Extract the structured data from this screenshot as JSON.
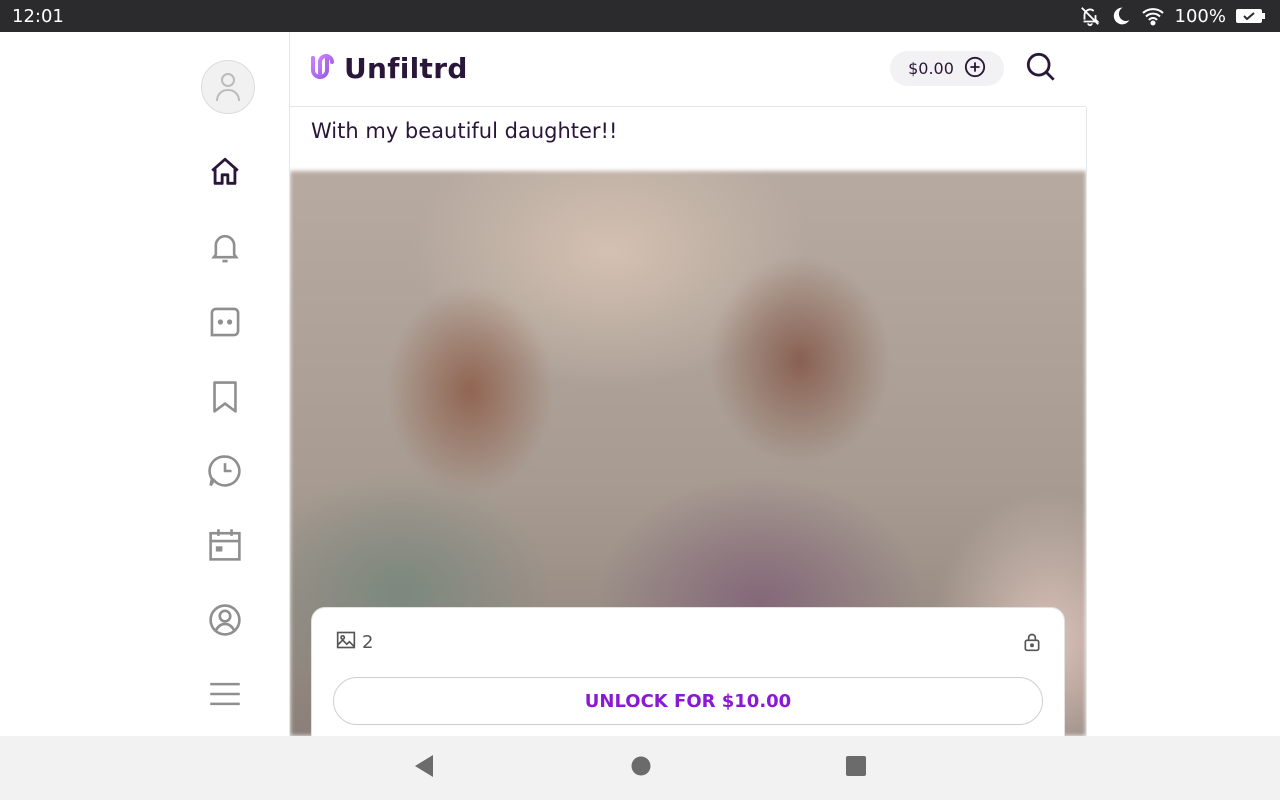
{
  "status_bar": {
    "time": "12:01",
    "battery": "100%",
    "icons": [
      "notifications-off-icon",
      "do-not-disturb-moon-icon",
      "wifi-icon",
      "battery-icon"
    ]
  },
  "sidebar": {
    "items": [
      {
        "name": "home",
        "icon": "home-icon"
      },
      {
        "name": "notifications",
        "icon": "bell-icon"
      },
      {
        "name": "messages",
        "icon": "chat-icon"
      },
      {
        "name": "saved",
        "icon": "bookmark-icon"
      },
      {
        "name": "history",
        "icon": "clock-chat-icon"
      },
      {
        "name": "calendar",
        "icon": "calendar-icon"
      },
      {
        "name": "profile",
        "icon": "user-circle-icon"
      },
      {
        "name": "menu",
        "icon": "hamburger-menu-icon"
      }
    ]
  },
  "header": {
    "brand": "Unfiltrd",
    "wallet_amount": "$0.00"
  },
  "post": {
    "caption": "With my beautiful daughter!!",
    "media_count": "2",
    "unlock_label": "UNLOCK FOR $10.00"
  },
  "colors": {
    "brand_dark": "#2a1639",
    "accent": "#8a19d6",
    "logo_gradient": [
      "#9b5de5",
      "#c77dff"
    ]
  }
}
